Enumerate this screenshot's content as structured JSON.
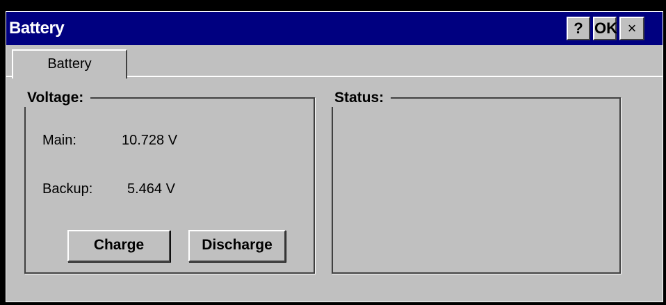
{
  "window": {
    "title": "Battery",
    "help_label": "?",
    "ok_label": "OK",
    "close_label": "×"
  },
  "tabs": [
    {
      "label": "Battery",
      "selected": true
    }
  ],
  "voltage": {
    "title": "Voltage:",
    "main_label": "Main:",
    "main_value": "10.728 V",
    "backup_label": "Backup:",
    "backup_value": "5.464 V",
    "charge_label": "Charge",
    "discharge_label": "Discharge"
  },
  "status": {
    "title": "Status:"
  },
  "colors": {
    "titlebar": "#000080",
    "face": "#c0c0c0"
  }
}
